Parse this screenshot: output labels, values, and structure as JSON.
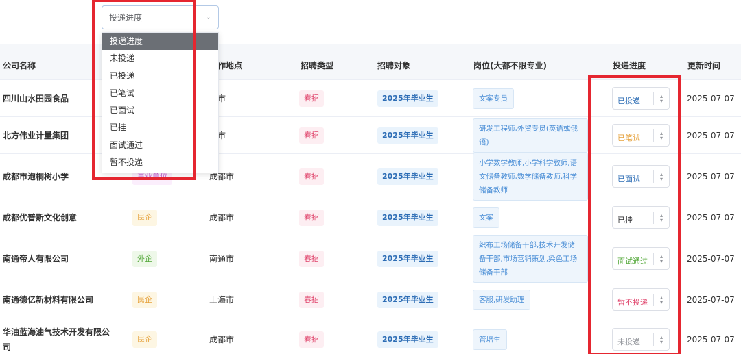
{
  "filter": {
    "select_placeholder": "投递进度",
    "chevron_glyph": "⌄",
    "options": [
      "投递进度",
      "未投递",
      "已投递",
      "已笔试",
      "已面试",
      "已挂",
      "面试通过",
      "暂不投递"
    ],
    "selected_index": 0
  },
  "table": {
    "headers": {
      "company": "公司名称",
      "location": "作地点",
      "recruit_type": "招聘类型",
      "target": "招聘对象",
      "position": "岗位(大都不限专业)",
      "progress": "投递进度",
      "updated": "更新时间"
    },
    "rows": [
      {
        "company": "四川山水田园食品",
        "nature": "",
        "location": "都市",
        "recruit_type": "春招",
        "target": "2025年毕业生",
        "position": "文案专员",
        "progress": "已投递",
        "updated": "2025-07-07"
      },
      {
        "company": "北方伟业计量集团",
        "nature": "",
        "location": "阳市",
        "recruit_type": "春招",
        "target": "2025年毕业生",
        "position": "研发工程师,外贸专员(英语或俄语)",
        "progress": "已笔试",
        "updated": "2025-07-07"
      },
      {
        "company": "成都市泡桐树小学",
        "nature": "事业单位",
        "location": "成都市",
        "recruit_type": "春招",
        "target": "2025年毕业生",
        "position": "小学数学教师,小学科学教师,语文储备教师,数学储备教师,科学储备教师",
        "progress": "已面试",
        "updated": "2025-07-07"
      },
      {
        "company": "成都优普斯文化创意",
        "nature": "民企",
        "location": "成都市",
        "recruit_type": "春招",
        "target": "2025年毕业生",
        "position": "文案",
        "progress": "已挂",
        "updated": "2025-07-07"
      },
      {
        "company": "南通帝人有限公司",
        "nature": "外企",
        "location": "南通市",
        "recruit_type": "春招",
        "target": "2025年毕业生",
        "position": "织布工场储备干部,技术开发储备干部,市场营销策划,染色工场储备干部",
        "progress": "面试通过",
        "updated": "2025-07-07"
      },
      {
        "company": "南通德亿新材料有限公司",
        "nature": "民企",
        "location": "上海市",
        "recruit_type": "春招",
        "target": "2025年毕业生",
        "position": "客服,研发助理",
        "progress": "暂不投递",
        "updated": "2025-07-07"
      },
      {
        "company": "华油蓝海油气技术开发有限公司",
        "nature": "民企",
        "location": "成都市",
        "recruit_type": "春招",
        "target": "2025年毕业生",
        "position": "管培生",
        "progress": "未投递",
        "updated": "2025-07-07"
      }
    ]
  },
  "colors": {
    "highlight_red": "#e52630",
    "status": {
      "已投递": "#2d6db5",
      "已笔试": "#e6a23c",
      "已面试": "#2d6db5",
      "已挂": "#303133",
      "面试通过": "#53a839",
      "暂不投递": "#e0436b",
      "未投递": "#909399"
    }
  }
}
